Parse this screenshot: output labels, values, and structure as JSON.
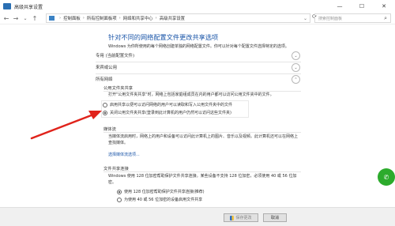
{
  "window": {
    "title": "高级共享设置",
    "minimize": "—",
    "maximize": "☐",
    "close": "✕"
  },
  "address": {
    "breadcrumbs": [
      "控制面板",
      "所有控制面板项",
      "网络和共享中心",
      "高级共享设置"
    ],
    "dropdown": "⌄",
    "search_placeholder": "搜索控制面板",
    "nav_back": "←",
    "nav_forward": "→",
    "nav_up": "↑",
    "nav_refresh": "⟳"
  },
  "main": {
    "heading": "针对不同的网络配置文件更改共享选项",
    "description": "Windows 为你所使用的每个网络创建单独的网络配置文件。你可以针对每个配置文件选择特定的选项。",
    "sections": [
      {
        "label": "专用 (当前配置文件)",
        "chevron": "⌄"
      },
      {
        "label": "来宾或公用",
        "chevron": "⌄"
      },
      {
        "label": "所有网络",
        "chevron": "⌃"
      }
    ],
    "public_folder": {
      "title": "公用文件夹共享",
      "text": "打开\"公用文件夹共享\"时，网络上包括家庭组成员在内的用户都可以访问公用文件夹中的文件。",
      "options": [
        {
          "label": "启用共享以便可以访问网络的用户可以读取和写入公用文件夹中的文件",
          "checked": false
        },
        {
          "label": "关闭公用文件夹共享(登录到此计算机的用户仍然可以访问这些文件夹)",
          "checked": true
        }
      ]
    },
    "media": {
      "title": "媒体流",
      "text": "当媒体流启用时，网络上的用户和设备可以访问此计算机上的图片、音乐以及视频。此计算机还可以在网络上查找媒体。",
      "link": "选择媒体流选项..."
    },
    "file_sharing": {
      "title": "文件共享连接",
      "text": "Windows 使用 128 位加密帮助保护文件共享连接。某些设备不支持 128 位加密，必须使用 40 或 56 位加密。",
      "options": [
        {
          "label": "使用 128 位加密帮助保护文件共享连接(推荐)",
          "checked": true
        },
        {
          "label": "为使用 40 或 56 位加密的设备启用文件共享",
          "checked": false
        }
      ]
    }
  },
  "footer": {
    "save_label": "保存更改",
    "cancel_label": "取消"
  },
  "colors": {
    "heading": "#1a55a8",
    "arrow": "#e0231b",
    "link": "#1a55a8"
  }
}
